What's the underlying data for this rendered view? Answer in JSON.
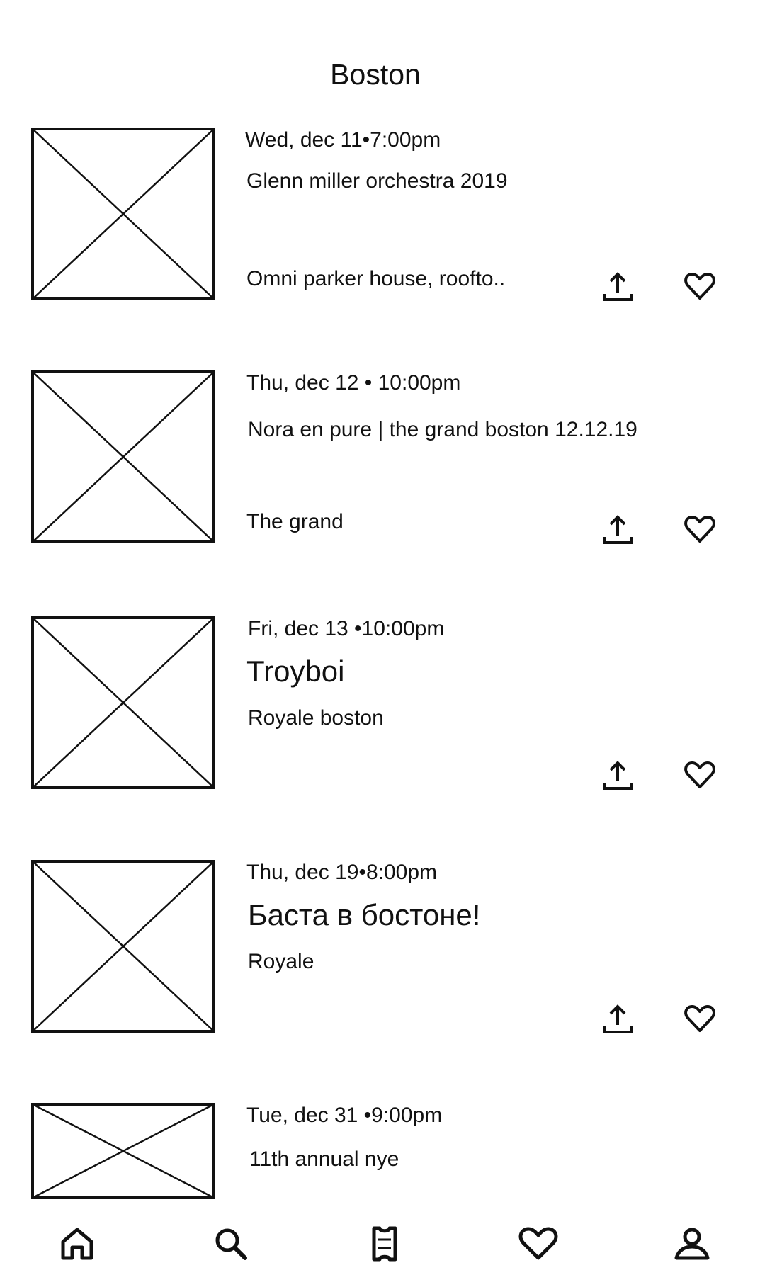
{
  "header": {
    "title": "Boston"
  },
  "events": [
    {
      "date": "Wed, dec 11•7:00pm",
      "title": "Glenn miller orchestra 2019",
      "venue": "Omni parker house, roofto.."
    },
    {
      "date": "Thu, dec 12 • 10:00pm",
      "title": "Nora en pure | the grand boston 12.12.19",
      "venue": "The grand"
    },
    {
      "date": "Fri, dec 13 •10:00pm",
      "title": "Troyboi",
      "venue": "Royale boston"
    },
    {
      "date": "Thu, dec 19•8:00pm",
      "title": "Баста в бостоне!",
      "venue": "Royale"
    },
    {
      "date": "Tue, dec 31 •9:00pm",
      "title": "11th annual nye",
      "venue": ""
    }
  ],
  "icons": {
    "share": "share-upload-icon",
    "favorite": "heart-outline-icon",
    "thumbnail": "image-placeholder-icon"
  },
  "nav": {
    "items": [
      {
        "name": "home",
        "icon": "home-icon"
      },
      {
        "name": "search",
        "icon": "search-icon"
      },
      {
        "name": "tickets",
        "icon": "ticket-icon"
      },
      {
        "name": "favorites",
        "icon": "heart-icon"
      },
      {
        "name": "profile",
        "icon": "profile-icon"
      }
    ]
  },
  "colors": {
    "ink": "#111111",
    "background": "#ffffff"
  }
}
